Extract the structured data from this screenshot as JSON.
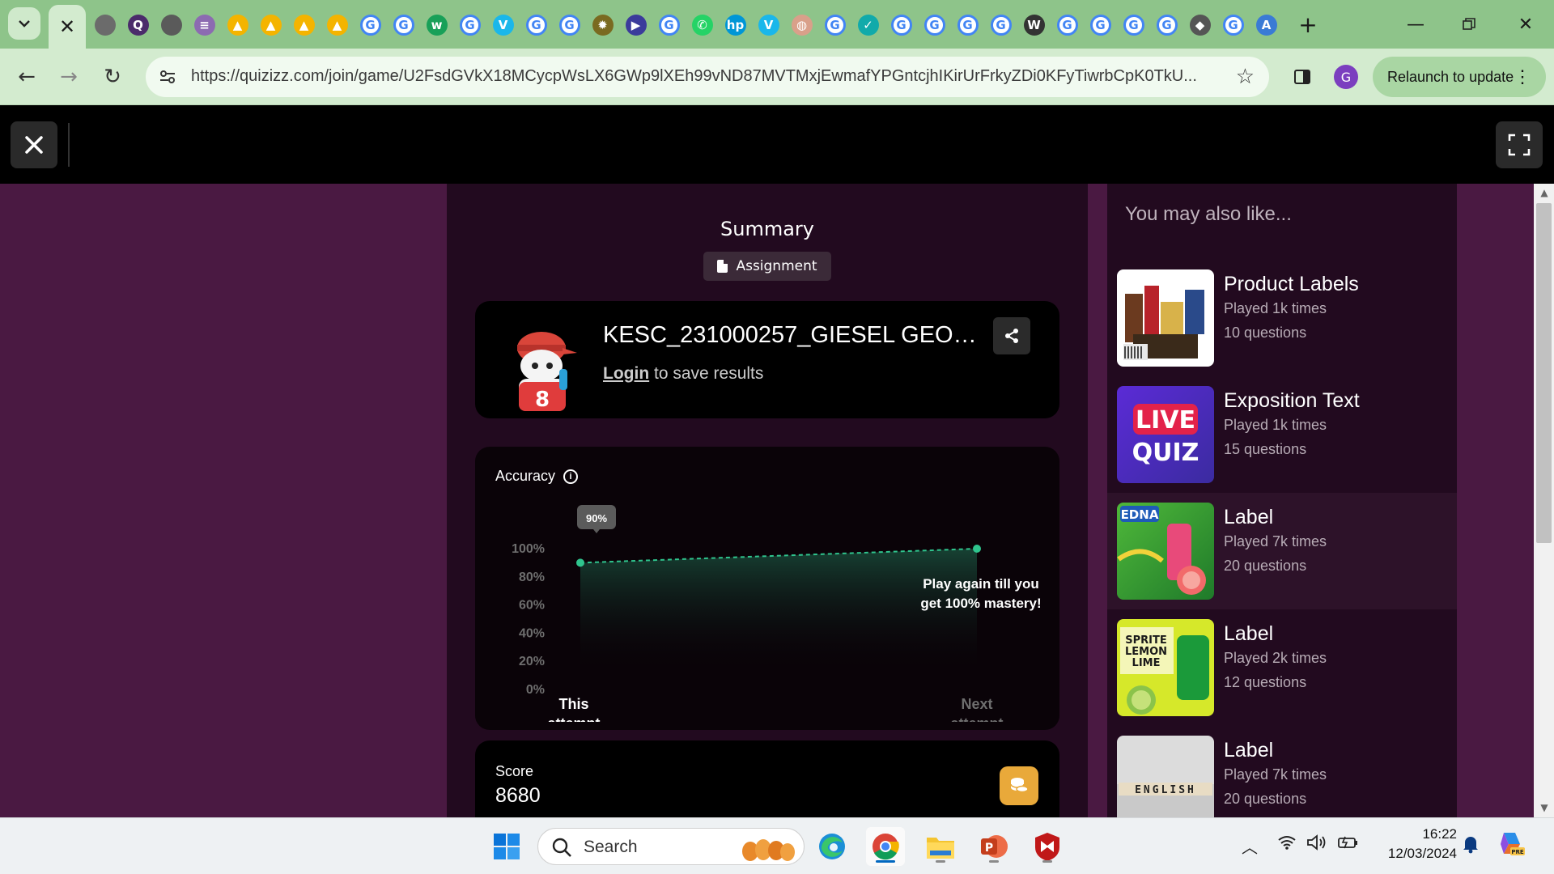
{
  "browser": {
    "tabs": [
      {
        "icon": "globe-icon",
        "color": "#6b6b6b",
        "glyph": ""
      },
      {
        "icon": "quizlet-icon",
        "color": "#4b2b6b",
        "glyph": "Q"
      },
      {
        "icon": "chromium-icon",
        "color": "#5a5a5a",
        "glyph": ""
      },
      {
        "icon": "layers-icon",
        "color": "#8c6bb1",
        "glyph": "≡"
      },
      {
        "icon": "google-drive-icon",
        "color": "#f4b400",
        "glyph": "▲"
      },
      {
        "icon": "google-drive-icon",
        "color": "#f4b400",
        "glyph": "▲"
      },
      {
        "icon": "google-drive-icon",
        "color": "#f4b400",
        "glyph": "▲"
      },
      {
        "icon": "google-drive-icon",
        "color": "#f4b400",
        "glyph": "▲"
      },
      {
        "icon": "google-icon",
        "color": "#4285f4",
        "glyph": "G"
      },
      {
        "icon": "google-icon",
        "color": "#4285f4",
        "glyph": "G"
      },
      {
        "icon": "wordwall-icon",
        "color": "#18a058",
        "glyph": "w"
      },
      {
        "icon": "google-icon",
        "color": "#4285f4",
        "glyph": "G"
      },
      {
        "icon": "vimeo-icon",
        "color": "#1ab7ea",
        "glyph": "V"
      },
      {
        "icon": "google-icon",
        "color": "#4285f4",
        "glyph": "G"
      },
      {
        "icon": "google-icon",
        "color": "#4285f4",
        "glyph": "G"
      },
      {
        "icon": "gear-site-icon",
        "color": "#7a6a20",
        "glyph": "✹"
      },
      {
        "icon": "play-icon",
        "color": "#3b3b9b",
        "glyph": "▶"
      },
      {
        "icon": "google-icon",
        "color": "#4285f4",
        "glyph": "G"
      },
      {
        "icon": "whatsapp-icon",
        "color": "#25d366",
        "glyph": "✆"
      },
      {
        "icon": "hp-icon",
        "color": "#0096d6",
        "glyph": "hp"
      },
      {
        "icon": "vimeo-icon",
        "color": "#1ab7ea",
        "glyph": "V"
      },
      {
        "icon": "egg-icon",
        "color": "#d9a08a",
        "glyph": "◍"
      },
      {
        "icon": "google-icon",
        "color": "#4285f4",
        "glyph": "G"
      },
      {
        "icon": "check-site-icon",
        "color": "#1aa",
        "glyph": "✓"
      },
      {
        "icon": "google-icon",
        "color": "#4285f4",
        "glyph": "G"
      },
      {
        "icon": "google-icon",
        "color": "#4285f4",
        "glyph": "G"
      },
      {
        "icon": "google-icon",
        "color": "#4285f4",
        "glyph": "G"
      },
      {
        "icon": "google-icon",
        "color": "#4285f4",
        "glyph": "G"
      },
      {
        "icon": "wikipedia-icon",
        "color": "#333333",
        "glyph": "W"
      },
      {
        "icon": "google-icon",
        "color": "#4285f4",
        "glyph": "G"
      },
      {
        "icon": "google-icon",
        "color": "#4285f4",
        "glyph": "G"
      },
      {
        "icon": "google-icon",
        "color": "#4285f4",
        "glyph": "G"
      },
      {
        "icon": "google-icon",
        "color": "#4285f4",
        "glyph": "G"
      },
      {
        "icon": "graduation-cap-icon",
        "color": "#555555",
        "glyph": "◆"
      },
      {
        "icon": "google-icon",
        "color": "#4285f4",
        "glyph": "G"
      },
      {
        "icon": "font-a-icon",
        "color": "#3a7bd5",
        "glyph": "A"
      }
    ],
    "url": "https://quizizz.com/join/game/U2FsdGVkX18MCycpWsLX6GWp9lXEh99vND87MVTMxjEwmafYPGntcjhIKirUrFrkyZDi0KFyTiwrbCpK0TkU...",
    "profile_initial": "G",
    "relaunch_label": "Relaunch to update",
    "accent": "#8ec48a"
  },
  "summary": {
    "title": "Summary",
    "badge": "Assignment"
  },
  "user": {
    "name": "KESC_231000257_GIESEL GEOV...",
    "login_link": "Login",
    "login_suffix": " to save results"
  },
  "accuracy": {
    "title": "Accuracy",
    "tooltip": "90%",
    "cta_line1": "Play again till you",
    "cta_line2": "get 100% mastery!"
  },
  "chart_data": {
    "type": "line",
    "x": [
      "This attempt",
      "Next attempt"
    ],
    "x_labels": [
      [
        "This",
        "attempt"
      ],
      [
        "Next",
        "attempt"
      ]
    ],
    "values": [
      90,
      100
    ],
    "y_ticks": [
      "100%",
      "80%",
      "60%",
      "40%",
      "20%",
      "0%"
    ],
    "ylim": [
      0,
      100
    ],
    "line_color": "#2fc48d"
  },
  "score": {
    "label": "Score",
    "value": "8680"
  },
  "recommendations": {
    "title": "You may also like...",
    "items": [
      {
        "name": "Product Labels",
        "played": "Played 1k times",
        "questions": "10 questions",
        "thumb": "products"
      },
      {
        "name": "Exposition Text",
        "played": "Played 1k times",
        "questions": "15 questions",
        "thumb": "live"
      },
      {
        "name": "Label",
        "played": "Played 7k times",
        "questions": "20 questions",
        "thumb": "edna"
      },
      {
        "name": "Label",
        "played": "Played 2k times",
        "questions": "12 questions",
        "thumb": "sprite"
      },
      {
        "name": "Label",
        "played": "Played 7k times",
        "questions": "20 questions",
        "thumb": "english"
      }
    ],
    "live_quiz_line1": "LIVE",
    "live_quiz_line2": "QUIZ",
    "edna_brand": "EDNA",
    "sprite_text": [
      "SPRITE",
      "LEMON",
      "LIME"
    ],
    "english_text": "ENGLISH"
  },
  "taskbar": {
    "search_label": "Search",
    "time": "16:22",
    "date": "12/03/2024"
  }
}
